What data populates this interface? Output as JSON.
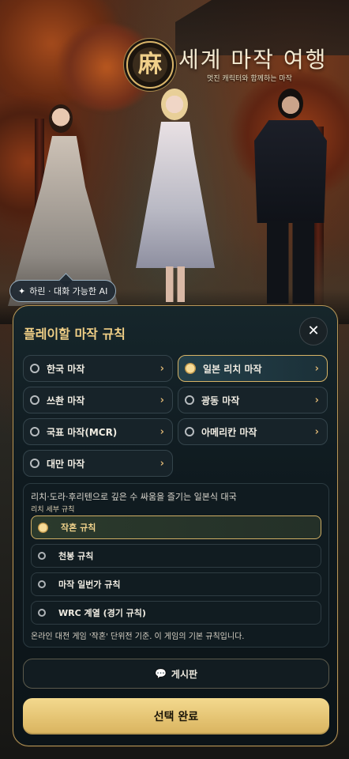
{
  "header": {
    "logo_glyph": "麻",
    "title": "세계 마작 여행",
    "subtitle": "멋진 캐릭터와 함께하는 마작"
  },
  "chip": {
    "icon": "sparkle-icon",
    "icon_glyph": "✦",
    "label": "하린 · 대화 가능한 AI"
  },
  "panel": {
    "title": "플레이할 마작 규칙",
    "close_glyph": "✕",
    "chevron_glyph": "›",
    "options": [
      {
        "label": "한국 마작",
        "selected": false
      },
      {
        "label": "일본 리치 마작",
        "selected": true
      },
      {
        "label": "쓰촨 마작",
        "selected": false
      },
      {
        "label": "광동 마작",
        "selected": false
      },
      {
        "label": "국표 마작(MCR)",
        "selected": false
      },
      {
        "label": "아메리칸 마작",
        "selected": false
      },
      {
        "label": "대만 마작",
        "selected": false
      }
    ],
    "sub": {
      "description": "리치·도라·후리텐으로 깊은 수 싸움을 즐기는 일본식 대국",
      "heading": "리치 세부 규칙",
      "rules": [
        {
          "label": "작혼 규칙",
          "selected": true
        },
        {
          "label": "천봉 규칙",
          "selected": false
        },
        {
          "label": "마작 일번가 규칙",
          "selected": false
        },
        {
          "label": "WRC 계열 (경기 규칙)",
          "selected": false
        }
      ],
      "note": "온라인 대전 게임 '작혼' 단위전 기준. 이 게임의 기본 규칙입니다."
    },
    "board_button": {
      "icon": "speech-bubble-icon",
      "icon_glyph": "💬",
      "label": "게시판"
    },
    "done_button": "선택 완료"
  },
  "colors": {
    "accent_gold": "#d8b466",
    "panel_bg": "#0f1a1f",
    "primary_button": "#e8c675"
  }
}
